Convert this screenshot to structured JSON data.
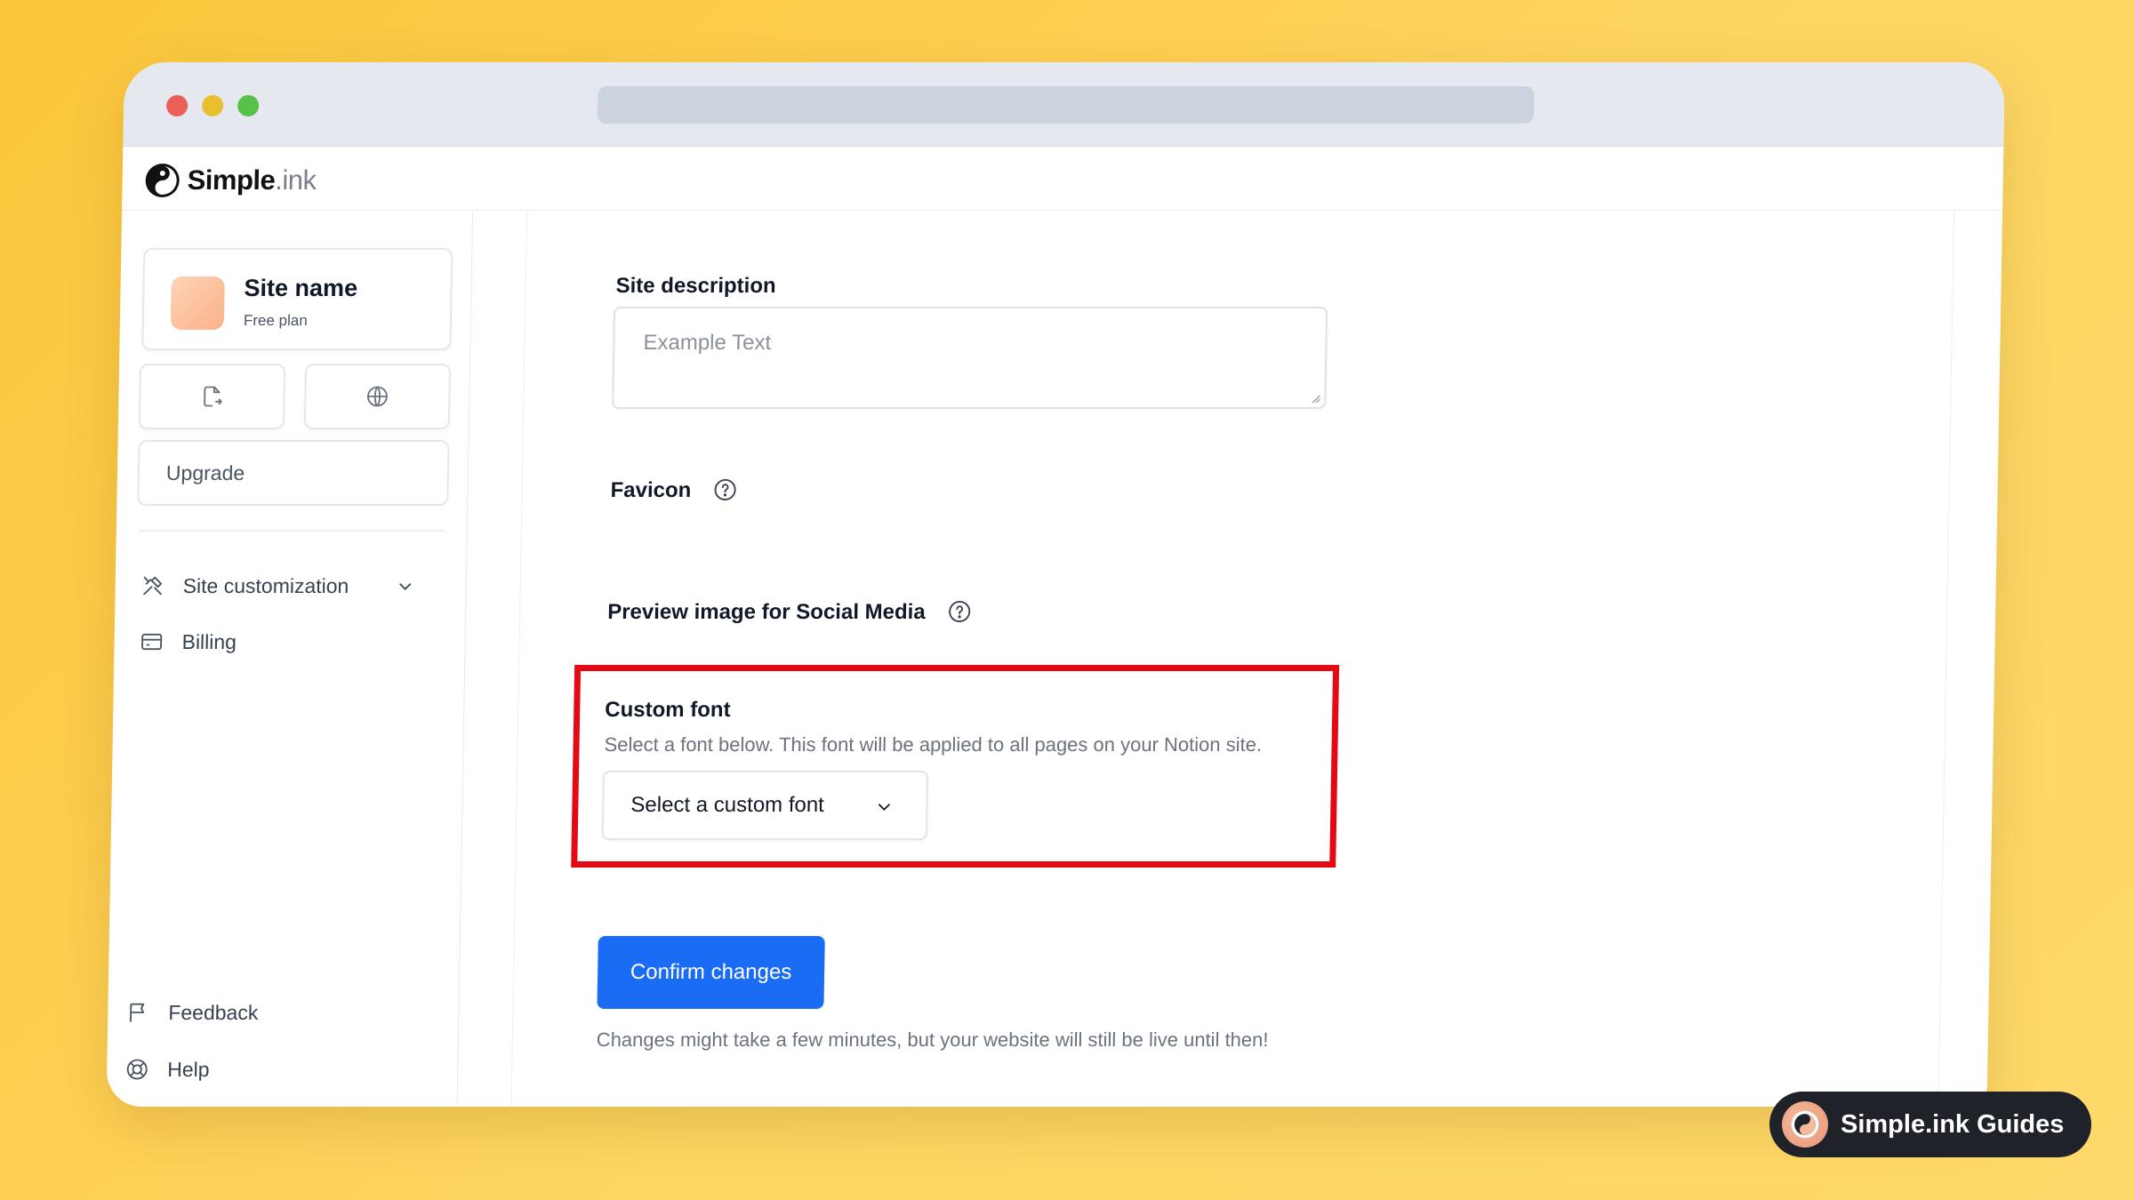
{
  "header": {
    "logo_text_main": "Simple",
    "logo_text_suffix": ".ink"
  },
  "sidebar": {
    "site_name": "Site name",
    "site_plan": "Free plan",
    "upgrade_label": "Upgrade",
    "items": [
      {
        "label": "Site customization",
        "icon": "tools-icon"
      },
      {
        "label": "Billing",
        "icon": "card-icon"
      }
    ],
    "footer_items": [
      {
        "label": "Feedback",
        "icon": "flag-icon"
      },
      {
        "label": "Help",
        "icon": "lifebuoy-icon"
      }
    ]
  },
  "main": {
    "site_description": {
      "label": "Site description",
      "placeholder": "Example Text"
    },
    "favicon_label": "Favicon",
    "preview_label": "Preview image for Social Media",
    "custom_font": {
      "label": "Custom font",
      "description": "Select a font below. This font will be applied to all pages on your Notion site.",
      "select_value": "Select a custom font"
    },
    "confirm_label": "Confirm changes",
    "confirm_note": "Changes might take a few minutes, but your website will still be live until then!"
  },
  "badge": {
    "label": "Simple.ink Guides"
  },
  "colors": {
    "accent": "#1a6cf5",
    "highlight": "#e50914",
    "background": "#fdd561"
  }
}
